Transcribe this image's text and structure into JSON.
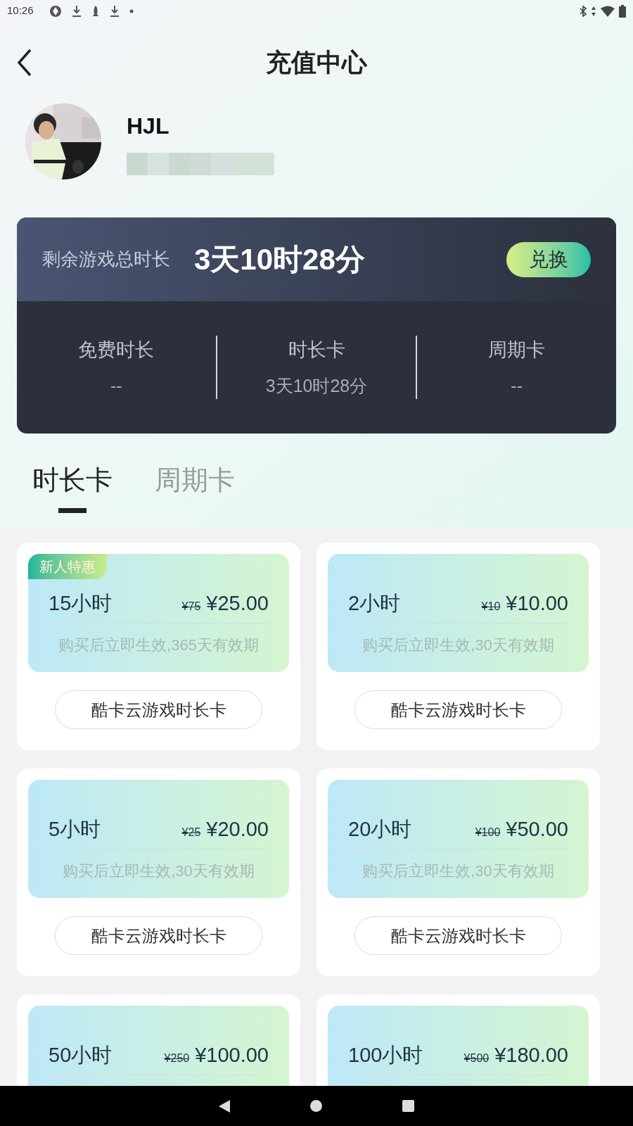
{
  "status_bar": {
    "time": "10:26"
  },
  "header": {
    "title": "充值中心"
  },
  "profile": {
    "name": "HJL"
  },
  "balance": {
    "label": "剩余游戏总时长",
    "value": "3天10时28分",
    "button": "兑换",
    "stats": [
      {
        "label": "免费时长",
        "value": "--"
      },
      {
        "label": "时长卡",
        "value": "3天10时28分"
      },
      {
        "label": "周期卡",
        "value": "--"
      }
    ]
  },
  "tabs": [
    {
      "label": "时长卡",
      "selected": true
    },
    {
      "label": "周期卡",
      "selected": false
    }
  ],
  "cards": [
    {
      "badge": "新人特惠",
      "hours": "15小时",
      "original_price": "¥75",
      "price": "¥25.00",
      "description": "购买后立即生效,365天有效期",
      "button": "酷卡云游戏时长卡"
    },
    {
      "hours": "2小时",
      "original_price": "¥10",
      "price": "¥10.00",
      "description": "购买后立即生效,30天有效期",
      "button": "酷卡云游戏时长卡"
    },
    {
      "hours": "5小时",
      "original_price": "¥25",
      "price": "¥20.00",
      "description": "购买后立即生效,30天有效期",
      "button": "酷卡云游戏时长卡"
    },
    {
      "hours": "20小时",
      "original_price": "¥100",
      "price": "¥50.00",
      "description": "购买后立即生效,30天有效期",
      "button": "酷卡云游戏时长卡"
    },
    {
      "hours": "50小时",
      "original_price": "¥250",
      "price": "¥100.00"
    },
    {
      "hours": "100小时",
      "original_price": "¥500",
      "price": "¥180.00"
    }
  ]
}
